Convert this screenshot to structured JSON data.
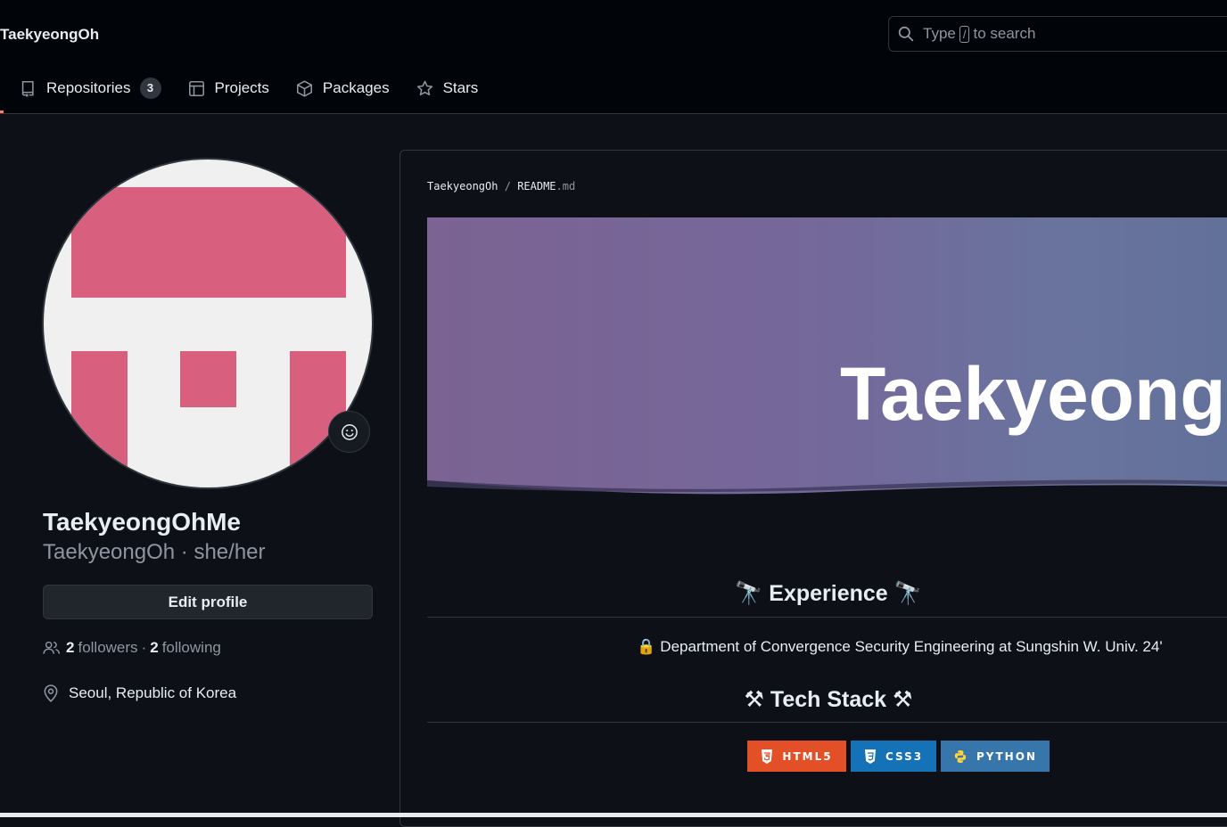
{
  "header": {
    "username": "TaekyeongOh",
    "search": {
      "prefix": "Type",
      "key": "/",
      "suffix": "to search"
    }
  },
  "tabs": [
    {
      "label": "Repositories",
      "count": "3",
      "icon": "repo-icon"
    },
    {
      "label": "Projects",
      "icon": "table-icon"
    },
    {
      "label": "Packages",
      "icon": "package-icon"
    },
    {
      "label": "Stars",
      "icon": "star-icon"
    }
  ],
  "profile": {
    "display_name": "TaekyeongOhMe",
    "login": "TaekyeongOh",
    "pronouns": "she/her",
    "separator": "·",
    "edit_label": "Edit profile",
    "followers_count": "2",
    "followers_label": "followers",
    "following_count": "2",
    "following_label": "following",
    "location": "Seoul, Republic of Korea",
    "avatar_colors": {
      "bg": "#f0f0f0",
      "fg": "#d95f7e"
    }
  },
  "readme": {
    "path_owner": "TaekyeongOh",
    "path_sep": "/",
    "path_file": "README",
    "path_ext": ".md",
    "banner_title": "Taekyeong",
    "experience_title": "Experience",
    "experience_emoji": "🔭",
    "experience_line": "Department of Convergence Security Engineering at Sungshin W. Univ. 24'",
    "experience_line_emoji": "🔒",
    "tech_title": "Tech Stack",
    "tech_emoji": "⚒",
    "badges": [
      {
        "label": "HTML5",
        "color": "#e34f26",
        "icon": "html5-icon"
      },
      {
        "label": "CSS3",
        "color": "#1572b6",
        "icon": "css3-icon"
      },
      {
        "label": "PYTHON",
        "color": "#3776ab",
        "icon": "python-icon"
      }
    ]
  }
}
